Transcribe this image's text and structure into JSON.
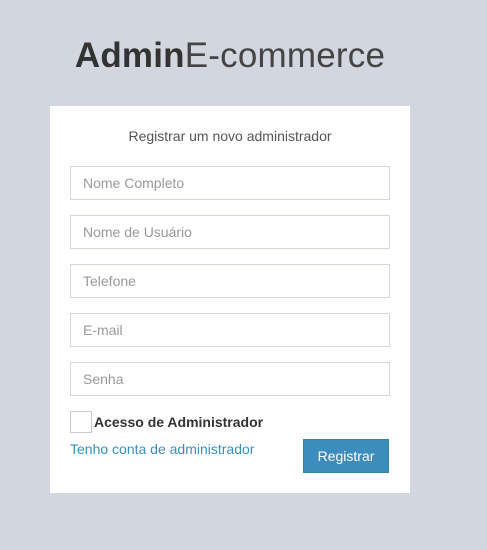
{
  "logo": {
    "bold": "Admin",
    "light": "E-commerce"
  },
  "form": {
    "message": "Registrar um novo administrador",
    "fields": [
      {
        "placeholder": "Nome Completo",
        "value": ""
      },
      {
        "placeholder": "Nome de Usuário",
        "value": ""
      },
      {
        "placeholder": "Telefone",
        "value": ""
      },
      {
        "placeholder": "E-mail",
        "value": ""
      },
      {
        "placeholder": "Senha",
        "value": ""
      }
    ],
    "admin_checkbox": {
      "label": "Acesso de Administrador",
      "checked": false
    },
    "login_link": "Tenho conta de administrador",
    "submit_label": "Registrar"
  },
  "colors": {
    "background": "#d2d6de",
    "accent": "#3c8dbc",
    "card": "#ffffff"
  }
}
